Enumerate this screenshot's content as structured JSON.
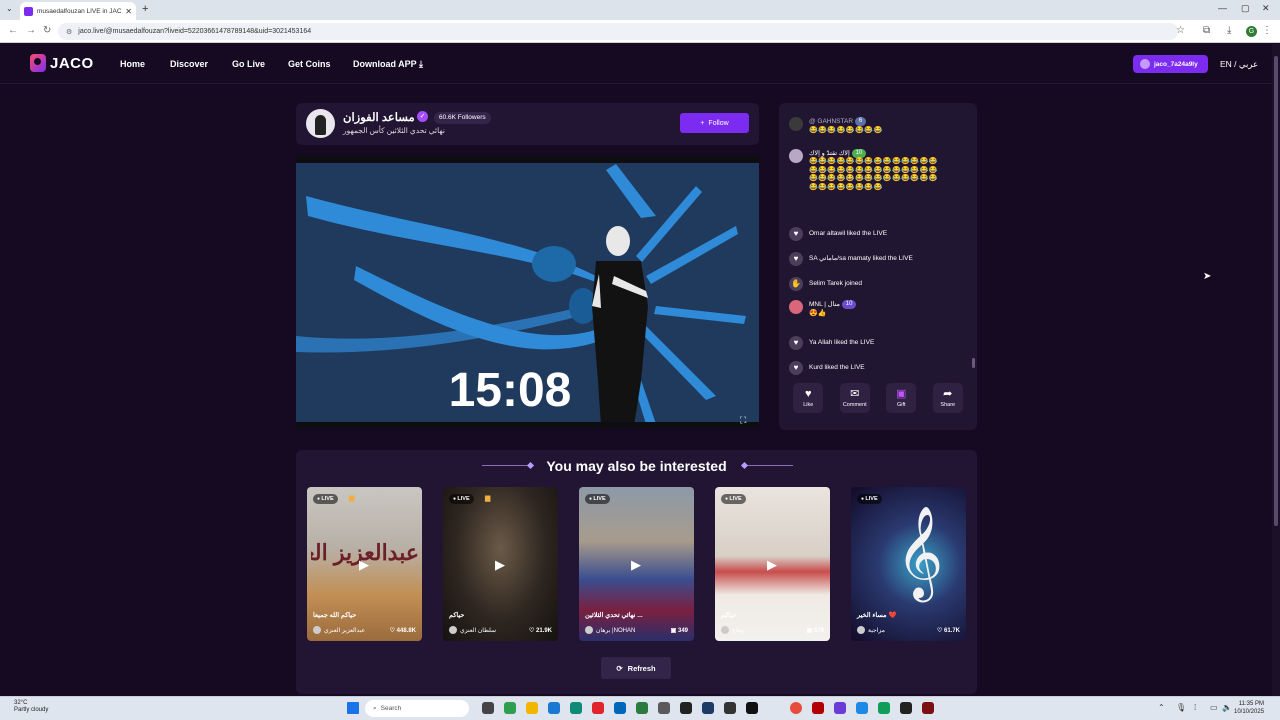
{
  "browser": {
    "tab_title": "musaedalfouzan LIVE in JACO...",
    "url": "jaco.live/@musaedalfouzan?liveid=52203661478789148&uid=3021453164"
  },
  "header": {
    "logo": "JACO",
    "nav": [
      "Home",
      "Discover",
      "Go Live",
      "Get Coins",
      "Download APP"
    ],
    "username": "jaco_7a24a9ly",
    "lang_en": "EN /",
    "lang_ar": "عربي"
  },
  "streamer": {
    "name": "مساعد الفوزان",
    "followers": "60.6K Followers",
    "subtitle": "نهائي تحدي الثلاثين كأس الجمهور",
    "follow_label": "Follow"
  },
  "video": {
    "timer": "15:08"
  },
  "chat": {
    "messages": [
      {
        "user": "@ GAHNSTAR",
        "level": "6",
        "content": "😂😂😂😂😂😂😂😂"
      },
      {
        "user": "إلاك تقتدّ و إلاك",
        "level": "10",
        "content": "😂😂😂😂😂😂😂😂😂😂😂😂😂😂😂😂😂😂😂😂😂😂😂😂😂😂😂😂😂😂😂😂😂😂😂😂😂😂😂😂😂😂😂😂😂😂😂😂😂😂"
      },
      {
        "text": "Omar altawil liked the LIVE"
      },
      {
        "text": "SA ماماتي/sa mamaty liked the LIVE"
      },
      {
        "text": "Selim Tarek joined"
      },
      {
        "user": "MNL | منال",
        "level": "10",
        "content": "😍👍"
      },
      {
        "text": "Ya Allah liked the LIVE"
      },
      {
        "text": "Kurd liked the LIVE"
      }
    ],
    "actions": [
      "Like",
      "Comment",
      "Gift",
      "Share"
    ]
  },
  "recommendations": {
    "title": "You may also be interested",
    "live_label": "LIVE",
    "cards": [
      {
        "title": "حياكم الله جميعا",
        "user": "عبدالعزيز العنزي",
        "count": "448.8K",
        "bg_text": "عبدالعزيز العنزي"
      },
      {
        "title": "حياكم",
        "user": "سلطان العنزي",
        "count": "21.9K"
      },
      {
        "title": "نهائي تحدي الثلاثين ...",
        "user": "برهان |NOHAN",
        "count": "349"
      },
      {
        "title": "حياكم",
        "user": "وهاج",
        "count": "579"
      },
      {
        "title": "مساء الخير ❤️",
        "user": "مزاجية",
        "count": "61.7K"
      }
    ],
    "refresh_label": "Refresh"
  },
  "taskbar": {
    "weather_temp": "32°C",
    "weather_desc": "Partly cloudy",
    "search_label": "Search",
    "time": "11:35 PM",
    "date": "10/10/2025"
  }
}
